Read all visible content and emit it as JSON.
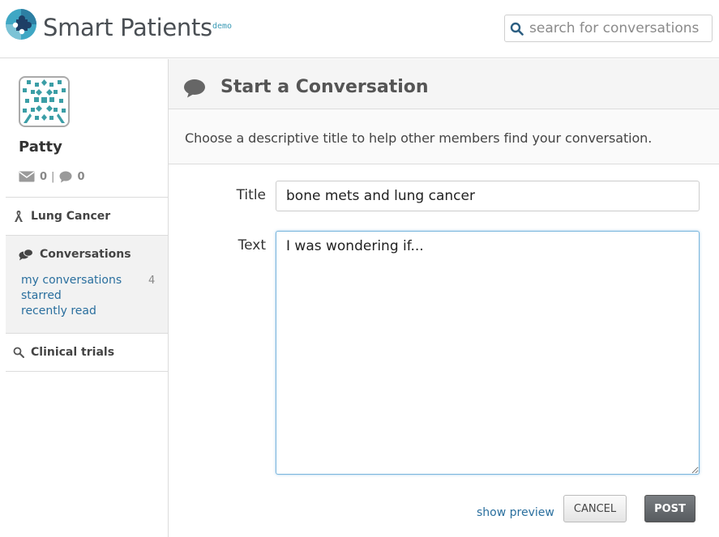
{
  "header": {
    "brand": "Smart Patients",
    "badge": "demo",
    "logo_icon": "puzzle-logo-icon",
    "search": {
      "placeholder": "search for conversations",
      "value": "",
      "icon": "search-icon"
    }
  },
  "sidebar": {
    "user": {
      "name": "Patty",
      "messages_count": "0",
      "separator": "|",
      "conversations_count": "0"
    },
    "condition": {
      "label": "Lung Cancer",
      "icon": "ribbon-icon"
    },
    "conversations": {
      "label": "Conversations",
      "icon": "chat-bubbles-icon",
      "links": [
        {
          "label": "my conversations",
          "count": "4"
        },
        {
          "label": "starred",
          "count": ""
        },
        {
          "label": "recently read",
          "count": ""
        }
      ]
    },
    "clinical_trials": {
      "label": "Clinical trials",
      "icon": "search-icon"
    }
  },
  "main": {
    "title": "Start a Conversation",
    "title_icon": "chat-bubble-icon",
    "description": "Choose a descriptive title to help other members find your conversation.",
    "form": {
      "title_label": "Title",
      "title_value": "bone mets and lung cancer",
      "text_label": "Text",
      "text_value": "I was wondering if..."
    },
    "actions": {
      "preview": "show preview",
      "cancel": "CANCEL",
      "post": "POST"
    }
  },
  "colors": {
    "link": "#2a6f9e",
    "brand_accent": "#3a9ab5",
    "focus_border": "#7ab6dd",
    "post_button": "#5f6367"
  }
}
